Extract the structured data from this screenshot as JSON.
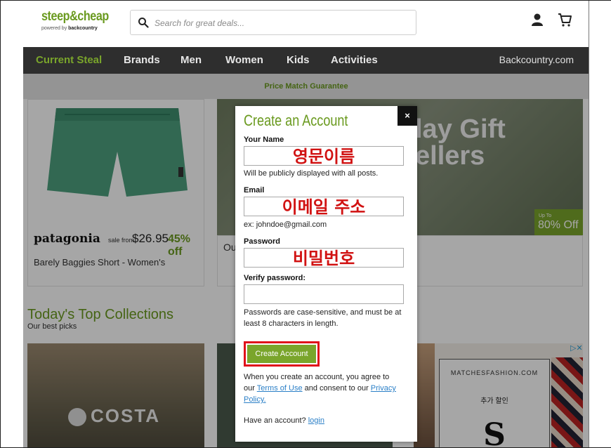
{
  "header": {
    "logo_main": "steep&cheap",
    "logo_sub_prefix": "powered by ",
    "logo_sub_brand": "backcountry",
    "search_placeholder": "Search for great deals..."
  },
  "nav": {
    "items": [
      "Current Steal",
      "Brands",
      "Men",
      "Women",
      "Kids",
      "Activities"
    ],
    "right": "Backcountry.com"
  },
  "promo": {
    "text": "Price Match Guarantee"
  },
  "product": {
    "brand": "patagonia",
    "sale_from": "sale from",
    "price": "$26.95",
    "discount": "45% off",
    "name": "Barely Baggies Short - Women's"
  },
  "hero": {
    "text_line1": "lay Gift",
    "text_line2": "ellers",
    "badge_upto": "Up To",
    "badge_pct": "80% Off",
    "card_text": "Ou"
  },
  "collections": {
    "title": "Today's Top Collections",
    "subtitle": "Our best picks",
    "costa": "COSTA"
  },
  "ad": {
    "title": "MATCHESFASHION.COM",
    "sale": "추가 할인",
    "letter": "S",
    "choice": "▷✕"
  },
  "modal": {
    "title": "Create an Account",
    "close": "×",
    "name_label": "Your Name",
    "name_overlay": "영문이름",
    "name_hint": "Will be publicly displayed with all posts.",
    "email_label": "Email",
    "email_overlay": "이메일 주소",
    "email_hint": "ex: johndoe@gmail.com",
    "password_label": "Password",
    "password_overlay": "비밀번호",
    "verify_label": "Verify password:",
    "password_hint_1": "Passwords are case-sensitive, and must be at",
    "password_hint_2": "least 8 characters in length.",
    "create_button": "Create Account",
    "terms_1": "When you create an account, you agree to",
    "terms_our": "our ",
    "terms_link": "Terms of Use",
    "terms_mid": " and consent to our ",
    "privacy_link_1": "Privacy",
    "privacy_link_2": "Policy.",
    "have_account": "Have an account? ",
    "login_link": "login"
  },
  "colors": {
    "brand_green": "#7aa52b",
    "nav_bg": "#2e2e2e",
    "highlight_red": "#e0101a",
    "link_blue": "#2a7fc7"
  }
}
